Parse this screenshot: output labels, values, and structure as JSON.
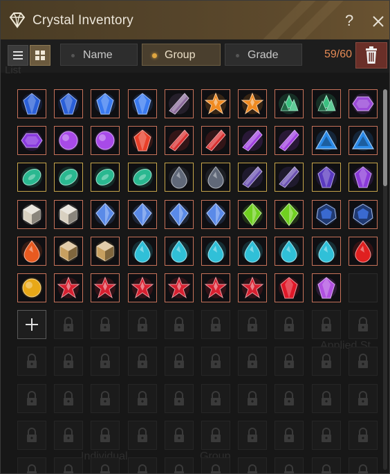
{
  "window": {
    "title": "Crystal Inventory",
    "help_glyph": "?",
    "icon": "diamond-icon"
  },
  "toolbar": {
    "view_list_icon": "list-view-icon",
    "view_grid_icon": "grid-view-icon",
    "active_view": "grid",
    "sort_options": [
      {
        "label": "Name",
        "selected": false
      },
      {
        "label": "Group",
        "selected": true
      },
      {
        "label": "Grade",
        "selected": false
      }
    ],
    "count": "59/60",
    "delete_icon": "trash-icon"
  },
  "background_text": [
    "List",
    "Applied St",
    "Individual",
    "Group"
  ],
  "colors": {
    "accent_gold": "#e0a640",
    "count_color": "#e58a55",
    "cell_border": "#c8735a",
    "cell_border_gold": "#c8a64a"
  },
  "grid": {
    "columns": 10,
    "rows": [
      [
        [
          "blue-sapphire-crystal",
          "#2a5fd8"
        ],
        [
          "blue-sapphire-crystal",
          "#2a5fd8"
        ],
        [
          "blue-sapphire-crystal",
          "#3a7af0"
        ],
        [
          "blue-sapphire-crystal",
          "#3a7af0"
        ],
        [
          "black-shard-crystal",
          "#8a6a9a"
        ],
        [
          "amber-star-crystal",
          "#f08a20"
        ],
        [
          "amber-star-crystal",
          "#f08a20"
        ],
        [
          "emerald-cluster-crystal",
          "#3ac080"
        ],
        [
          "emerald-cluster-crystal",
          "#3ac080"
        ],
        [
          "amethyst-hex-crystal",
          "#9a4ad8"
        ]
      ],
      [
        [
          "amethyst-hex-crystal",
          "#8a3ae0"
        ],
        [
          "amethyst-round-crystal",
          "#a84ae8"
        ],
        [
          "amethyst-round-crystal",
          "#a84ae8"
        ],
        [
          "ruby-cut-crystal",
          "#e8402a"
        ],
        [
          "red-shard-crystal",
          "#d83030"
        ],
        [
          "red-shard-crystal",
          "#d83030"
        ],
        [
          "violet-shard-crystal",
          "#a040e0"
        ],
        [
          "violet-shard-crystal",
          "#a040e0"
        ],
        [
          "blue-triangle-crystal",
          "#2a8ae8"
        ],
        [
          "blue-triangle-crystal",
          "#2a8ae8"
        ]
      ],
      [
        [
          "jade-crystal",
          "#2ab890"
        ],
        [
          "jade-crystal",
          "#2ab890"
        ],
        [
          "jade-crystal",
          "#2ab890"
        ],
        [
          "jade-crystal",
          "#2ab890"
        ],
        [
          "black-teardrop-crystal",
          "#606878"
        ],
        [
          "black-teardrop-crystal",
          "#606878"
        ],
        [
          "dark-violet-shard-crystal",
          "#6a50b0"
        ],
        [
          "dark-violet-shard-crystal",
          "#6a50b0"
        ],
        [
          "dark-violet-gem-crystal",
          "#5a3ac0"
        ],
        [
          "violet-gem-crystal",
          "#8a3ad8"
        ]
      ],
      [
        [
          "white-cube-crystal",
          "#d8d0c0"
        ],
        [
          "white-cube-crystal",
          "#d8d0c0"
        ],
        [
          "blue-prism-crystal",
          "#5a8ae8"
        ],
        [
          "blue-prism-crystal",
          "#5a8ae8"
        ],
        [
          "blue-prism-crystal",
          "#5a8ae8"
        ],
        [
          "blue-prism-crystal",
          "#5a8ae8"
        ],
        [
          "green-prism-crystal",
          "#70d020"
        ],
        [
          "green-prism-crystal",
          "#70d020"
        ],
        [
          "navy-geode-crystal",
          "#3a6ad0"
        ],
        [
          "navy-geode-crystal",
          "#3a6ad0"
        ]
      ],
      [
        [
          "fire-drop-crystal",
          "#e85a20"
        ],
        [
          "gold-cube-crystal",
          "#c8a060"
        ],
        [
          "gold-cube-crystal",
          "#c8a060"
        ],
        [
          "aqua-drop-crystal",
          "#30c0d8"
        ],
        [
          "aqua-drop-crystal",
          "#30c0d8"
        ],
        [
          "aqua-drop-crystal",
          "#30c0d8"
        ],
        [
          "aqua-drop-crystal",
          "#30c0d8"
        ],
        [
          "aqua-drop-crystal",
          "#30c0d8"
        ],
        [
          "aqua-drop-crystal",
          "#30c0d8"
        ],
        [
          "ruby-drop-crystal",
          "#e02020"
        ]
      ],
      [
        [
          "topaz-orb-crystal",
          "#e8a818"
        ],
        [
          "red-star-crystal",
          "#d82030"
        ],
        [
          "red-star-crystal",
          "#d82030"
        ],
        [
          "red-star-crystal",
          "#d82030"
        ],
        [
          "red-star-crystal",
          "#d82030"
        ],
        [
          "red-star-crystal",
          "#d82030"
        ],
        [
          "red-star-crystal",
          "#d82030"
        ],
        [
          "ruby-small-crystal",
          "#e01828"
        ],
        [
          "violet-small-crystal",
          "#b050e0"
        ],
        [
          "empty-slot",
          ""
        ]
      ]
    ],
    "add_slot_icon": "plus-icon",
    "locked_slot_icon": "lock-icon",
    "locked_rows": 5
  },
  "scrollbar": {
    "position": 0
  }
}
